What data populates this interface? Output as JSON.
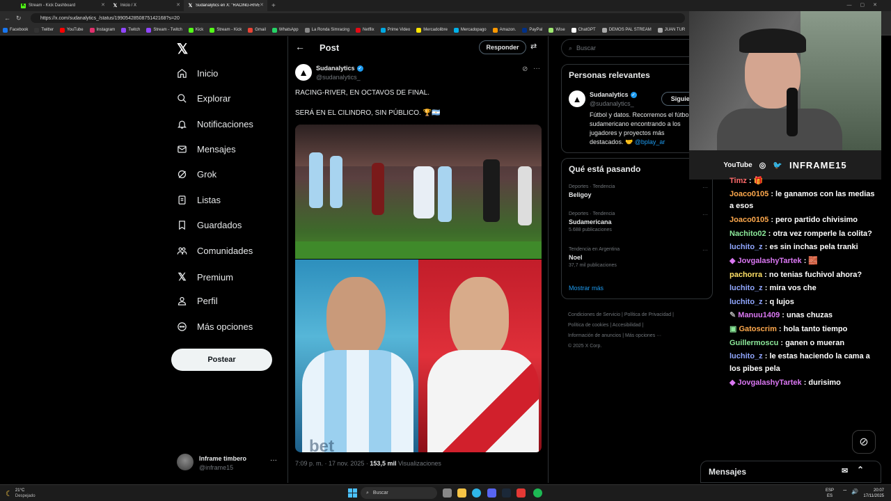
{
  "browser": {
    "tabs": [
      {
        "label": "Stream - Kick Dashboard",
        "icon": "kick-icon"
      },
      {
        "label": "Inicio / X",
        "icon": "x-icon"
      },
      {
        "label": "Sudanalytics en X: \"RACING-RIVE",
        "icon": "x-icon"
      }
    ],
    "url": "https://x.com/sudanalytics_/status/1990542850875142168?s=20",
    "bookmarks": [
      "Facebook",
      "Twitter",
      "YouTube",
      "Instagram",
      "Twitch",
      "Stream - Twitch",
      "Kick",
      "Stream - Kick",
      "Gmail",
      "WhatsApp",
      "La Ronda Simracing",
      "Netflix",
      "Prime Video",
      "Mercadolibre",
      "Mercadopago",
      "Amazon.",
      "PayPal",
      "Wise",
      "ChatGPT",
      "DEMOS PAL STREAM",
      "JUAN TUR"
    ]
  },
  "leftnav": {
    "items": [
      "Inicio",
      "Explorar",
      "Notificaciones",
      "Mensajes",
      "Grok",
      "Listas",
      "Guardados",
      "Comunidades",
      "Premium",
      "Perfil",
      "Más opciones"
    ],
    "post_button": "Postear",
    "profile_name": "Inframe timbero",
    "profile_handle": "@inframe15"
  },
  "post": {
    "header_title": "Post",
    "reply_button": "Responder",
    "author_name": "Sudanalytics",
    "author_handle": "@sudanalytics_",
    "text_line1": "RACING-RIVER, EN OCTAVOS DE FINAL.",
    "text_line2": "SERÁ EN EL CILINDRO, SIN PÚBLICO. 🏆🇦🇷",
    "image_caption": "bet",
    "timestamp": "7:09 p. m. · 17 nov. 2025 ·",
    "views_count": "153,5 mil",
    "views_label": "Visualizaciones"
  },
  "sidebar": {
    "search_placeholder": "Buscar",
    "relevant_title": "Personas relevantes",
    "relevant_name": "Sudanalytics",
    "relevant_handle": "@sudanalytics_",
    "follow_button": "Siguien",
    "relevant_bio_1": "Fútbol y datos. Recorremos el fútbol",
    "relevant_bio_2": "sudamericano encontrando a los",
    "relevant_bio_3": "jugadores y proyectos más",
    "relevant_bio_4": "destacados. 🤝",
    "relevant_bio_link": "@bplay_ar",
    "trending_title": "Qué está pasando",
    "trends": [
      {
        "context": "Deportes · Tendencia",
        "name": "Beligoy",
        "count": ""
      },
      {
        "context": "Deportes · Tendencia",
        "name": "Sudamericana",
        "count": "5.688 publicaciones"
      },
      {
        "context": "Tendencia en Argentina",
        "name": "Noel",
        "count": "37,7 mil publicaciones"
      }
    ],
    "show_more": "Mostrar más",
    "footer_1": "Condiciones de Servicio",
    "footer_2": "Política de Privacidad",
    "footer_3": "Política de cookies",
    "footer_4": "Accesibilidad",
    "footer_5": "Información de anuncios",
    "footer_6": "Más opciones ···",
    "footer_7": "© 2025 X Corp."
  },
  "webcam": {
    "youtube_label": "YouTube",
    "channel_name": "INFRAME15"
  },
  "chat": {
    "messages": [
      {
        "user": "Timz",
        "color": "#ff6b6b",
        "text": "🎁"
      },
      {
        "user": "Joaco0105",
        "color": "#ffa94d",
        "text": "le ganamos con las medias"
      },
      {
        "user": "",
        "color": "#ffffff",
        "text": "a esos"
      },
      {
        "user": "Joaco0105",
        "color": "#ffa94d",
        "text": "pero partido chivisimo"
      },
      {
        "user": "Nachito02",
        "color": "#8ce99a",
        "text": "otra vez romperle la colita?"
      },
      {
        "user": "luchito_z",
        "color": "#91a7ff",
        "text": "es sin inchas pela tranki"
      },
      {
        "user": "JovgalashyTartek",
        "color": "#da77f2",
        "text": "🧱"
      },
      {
        "user": "pachorra",
        "color": "#ffe066",
        "text": "no tenias fuchivol ahora?"
      },
      {
        "user": "luchito_z",
        "color": "#91a7ff",
        "text": "mira vos che"
      },
      {
        "user": "luchito_z",
        "color": "#91a7ff",
        "text": "q lujos"
      },
      {
        "user": "Manuu1409",
        "color": "#da77f2",
        "text": "unas chuzas"
      },
      {
        "user": "Gatoscrim",
        "color": "#ffa94d",
        "text": "hola tanto tiempo"
      },
      {
        "user": "Guillermoscu",
        "color": "#8ce99a",
        "text": "ganen o mueran"
      },
      {
        "user": "luchito_z",
        "color": "#91a7ff",
        "text": "le estas haciendo la cama a"
      },
      {
        "user": "",
        "color": "#ffffff",
        "text": "los pibes pela"
      },
      {
        "user": "JovgalashyTartek",
        "color": "#da77f2",
        "text": "durisimo"
      }
    ],
    "messages_panel": "Mensajes"
  },
  "taskbar": {
    "weather_temp": "21°C",
    "weather_desc": "Despejado",
    "search": "Buscar",
    "lang_1": "ESP",
    "lang_2": "ES",
    "time": "20:07",
    "date": "17/11/2025"
  }
}
